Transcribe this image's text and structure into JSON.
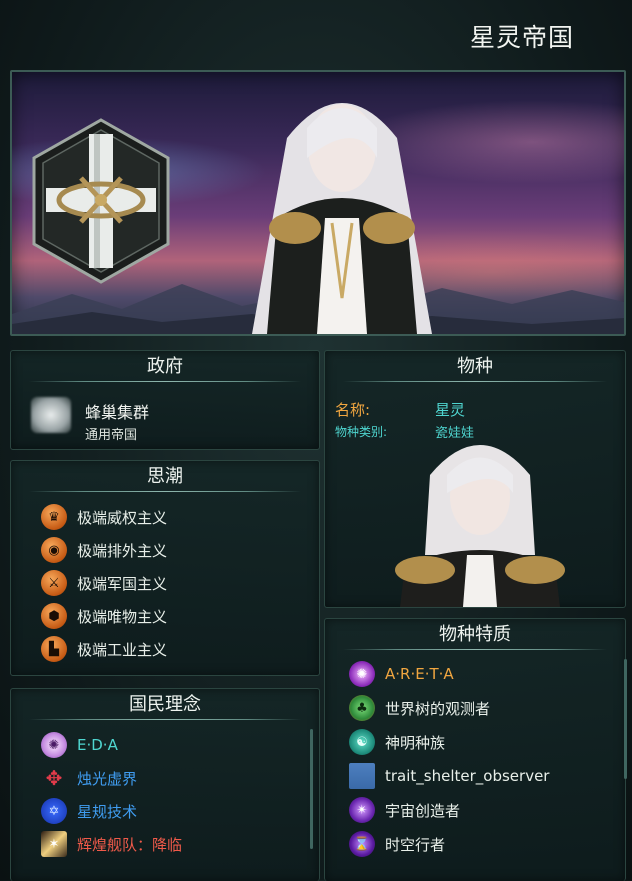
{
  "empire_title": "星灵帝国",
  "government": {
    "heading": "政府",
    "authority": "蜂巢集群",
    "civic_type": "通用帝国"
  },
  "ethics": {
    "heading": "思潮",
    "items": [
      {
        "label": "极端威权主义",
        "icon": "crown-icon"
      },
      {
        "label": "极端排外主义",
        "icon": "xenophobe-icon"
      },
      {
        "label": "极端军国主义",
        "icon": "crossed-swords-icon"
      },
      {
        "label": "极端唯物主义",
        "icon": "atom-icon"
      },
      {
        "label": "极端工业主义",
        "icon": "factory-icon"
      }
    ]
  },
  "civics": {
    "heading": "国民理念",
    "items": [
      {
        "label": "E·D·A",
        "color": "#4fd6d0",
        "icon": "eda-sigil-icon"
      },
      {
        "label": "烛光虚界",
        "color": "#3f9cf0",
        "icon": "void-compass-icon"
      },
      {
        "label": "星规技术",
        "color": "#3f9cf0",
        "icon": "star-hexagram-icon"
      },
      {
        "label": "辉煌舰队：降临",
        "color": "#f05a4a",
        "icon": "fleet-burst-icon"
      }
    ]
  },
  "species": {
    "heading": "物种",
    "name_label": "名称:",
    "name_value": "星灵",
    "class_label": "物种类别:",
    "class_value": "瓷娃娃"
  },
  "traits": {
    "heading": "物种特质",
    "items": [
      {
        "label": "A·R·E·T·A",
        "color": "#f0a640",
        "icon": "areta-sigil-icon"
      },
      {
        "label": "世界树的观测者",
        "color": "#e8efe9",
        "icon": "world-tree-icon"
      },
      {
        "label": "神明种族",
        "color": "#e8efe9",
        "icon": "divine-icon"
      },
      {
        "label": "trait_shelter_observer",
        "color": "#e8efe9",
        "icon": "placeholder-trait-icon"
      },
      {
        "label": "宇宙创造者",
        "color": "#e8efe9",
        "icon": "cosmos-creator-icon"
      },
      {
        "label": "时空行者",
        "color": "#e8efe9",
        "icon": "time-walker-icon"
      }
    ]
  },
  "colors": {
    "accent_orange": "#f0a640",
    "accent_teal": "#4fd6d0",
    "accent_blue": "#3f9cf0",
    "accent_red": "#f05a4a",
    "panel_border": "#2b4540"
  }
}
